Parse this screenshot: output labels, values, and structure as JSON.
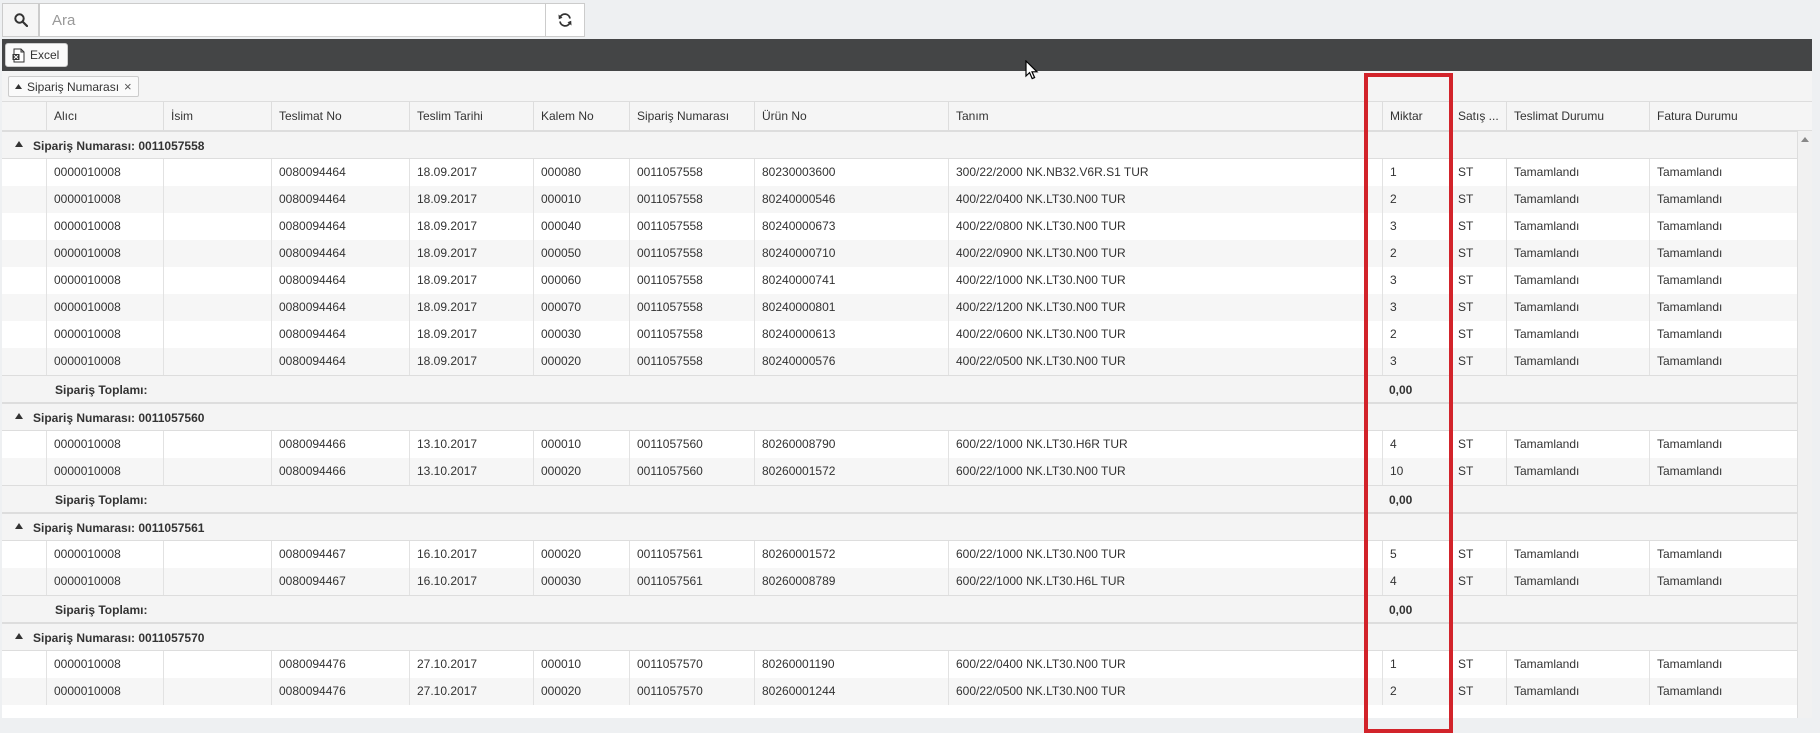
{
  "search": {
    "placeholder": "Ara",
    "value": ""
  },
  "toolbar": {
    "excel_label": "Excel"
  },
  "group_panel": {
    "chip_label": "Sipariş Numarası"
  },
  "columns": [
    "Alıcı",
    "İsim",
    "Teslimat No",
    "Teslim Tarihi",
    "Kalem No",
    "Sipariş Numarası",
    "Ürün No",
    "Tanım",
    "Miktar",
    "Satış ...",
    "Teslimat Durumu",
    "Fatura Durumu"
  ],
  "footer_label": "Sipariş Toplamı:",
  "groups": [
    {
      "title": "Sipariş Numarası: 0011057558",
      "total": "0,00",
      "rows": [
        [
          "0000010008",
          "",
          "0080094464",
          "18.09.2017",
          "000080",
          "0011057558",
          "80230003600",
          "300/22/2000 NK.NB32.V6R.S1 TUR",
          "1",
          "ST",
          "Tamamlandı",
          "Tamamlandı"
        ],
        [
          "0000010008",
          "",
          "0080094464",
          "18.09.2017",
          "000010",
          "0011057558",
          "80240000546",
          "400/22/0400 NK.LT30.N00 TUR",
          "2",
          "ST",
          "Tamamlandı",
          "Tamamlandı"
        ],
        [
          "0000010008",
          "",
          "0080094464",
          "18.09.2017",
          "000040",
          "0011057558",
          "80240000673",
          "400/22/0800 NK.LT30.N00 TUR",
          "3",
          "ST",
          "Tamamlandı",
          "Tamamlandı"
        ],
        [
          "0000010008",
          "",
          "0080094464",
          "18.09.2017",
          "000050",
          "0011057558",
          "80240000710",
          "400/22/0900 NK.LT30.N00 TUR",
          "2",
          "ST",
          "Tamamlandı",
          "Tamamlandı"
        ],
        [
          "0000010008",
          "",
          "0080094464",
          "18.09.2017",
          "000060",
          "0011057558",
          "80240000741",
          "400/22/1000 NK.LT30.N00 TUR",
          "3",
          "ST",
          "Tamamlandı",
          "Tamamlandı"
        ],
        [
          "0000010008",
          "",
          "0080094464",
          "18.09.2017",
          "000070",
          "0011057558",
          "80240000801",
          "400/22/1200 NK.LT30.N00 TUR",
          "3",
          "ST",
          "Tamamlandı",
          "Tamamlandı"
        ],
        [
          "0000010008",
          "",
          "0080094464",
          "18.09.2017",
          "000030",
          "0011057558",
          "80240000613",
          "400/22/0600 NK.LT30.N00 TUR",
          "2",
          "ST",
          "Tamamlandı",
          "Tamamlandı"
        ],
        [
          "0000010008",
          "",
          "0080094464",
          "18.09.2017",
          "000020",
          "0011057558",
          "80240000576",
          "400/22/0500 NK.LT30.N00 TUR",
          "3",
          "ST",
          "Tamamlandı",
          "Tamamlandı"
        ]
      ]
    },
    {
      "title": "Sipariş Numarası: 0011057560",
      "total": "0,00",
      "rows": [
        [
          "0000010008",
          "",
          "0080094466",
          "13.10.2017",
          "000010",
          "0011057560",
          "80260008790",
          "600/22/1000 NK.LT30.H6R TUR",
          "4",
          "ST",
          "Tamamlandı",
          "Tamamlandı"
        ],
        [
          "0000010008",
          "",
          "0080094466",
          "13.10.2017",
          "000020",
          "0011057560",
          "80260001572",
          "600/22/1000 NK.LT30.N00 TUR",
          "10",
          "ST",
          "Tamamlandı",
          "Tamamlandı"
        ]
      ]
    },
    {
      "title": "Sipariş Numarası: 0011057561",
      "total": "0,00",
      "rows": [
        [
          "0000010008",
          "",
          "0080094467",
          "16.10.2017",
          "000020",
          "0011057561",
          "80260001572",
          "600/22/1000 NK.LT30.N00 TUR",
          "5",
          "ST",
          "Tamamlandı",
          "Tamamlandı"
        ],
        [
          "0000010008",
          "",
          "0080094467",
          "16.10.2017",
          "000030",
          "0011057561",
          "80260008789",
          "600/22/1000 NK.LT30.H6L TUR",
          "4",
          "ST",
          "Tamamlandı",
          "Tamamlandı"
        ]
      ]
    },
    {
      "title": "Sipariş Numarası: 0011057570",
      "rows": [
        [
          "0000010008",
          "",
          "0080094476",
          "27.10.2017",
          "000010",
          "0011057570",
          "80260001190",
          "600/22/0400 NK.LT30.N00 TUR",
          "1",
          "ST",
          "Tamamlandı",
          "Tamamlandı"
        ],
        [
          "0000010008",
          "",
          "0080094476",
          "27.10.2017",
          "000020",
          "0011057570",
          "80260001244",
          "600/22/0500 NK.LT30.N00 TUR",
          "2",
          "ST",
          "Tamamlandı",
          "Tamamlandı"
        ]
      ]
    }
  ],
  "highlight_color": "#d2232a"
}
